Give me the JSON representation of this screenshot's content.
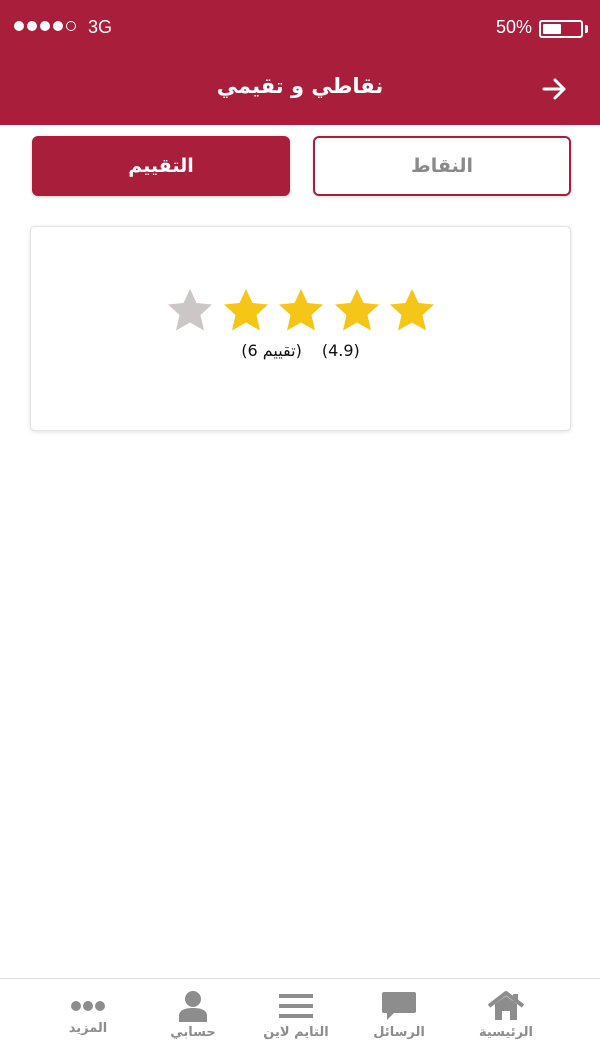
{
  "status_bar": {
    "carrier": "3G",
    "battery": "50%",
    "battery_level": 0.5,
    "signal_bars": 4
  },
  "header": {
    "title": "نقاطي و تقيمي"
  },
  "segments": {
    "points_label": "النقاط",
    "rating_label": "التقييم",
    "selected": "rating"
  },
  "rating_card": {
    "stars_filled": 4,
    "stars_total": 5,
    "score": "(4.9)",
    "count": "(تقييم 6)"
  },
  "colors": {
    "brand": "#a91f3b",
    "star_filled": "#f5c518",
    "star_empty": "#cdc6c6",
    "nav_gray": "#8d8d8d"
  },
  "bottom_nav": {
    "items": [
      {
        "label": "الرئيسية",
        "icon": "home-icon"
      },
      {
        "label": "الرسائل",
        "icon": "chat-icon"
      },
      {
        "label": "التايم لاين",
        "icon": "menu-lines-icon"
      },
      {
        "label": "حسابي",
        "icon": "user-icon"
      },
      {
        "label": "المزيد",
        "icon": "more-dots-icon"
      }
    ]
  }
}
